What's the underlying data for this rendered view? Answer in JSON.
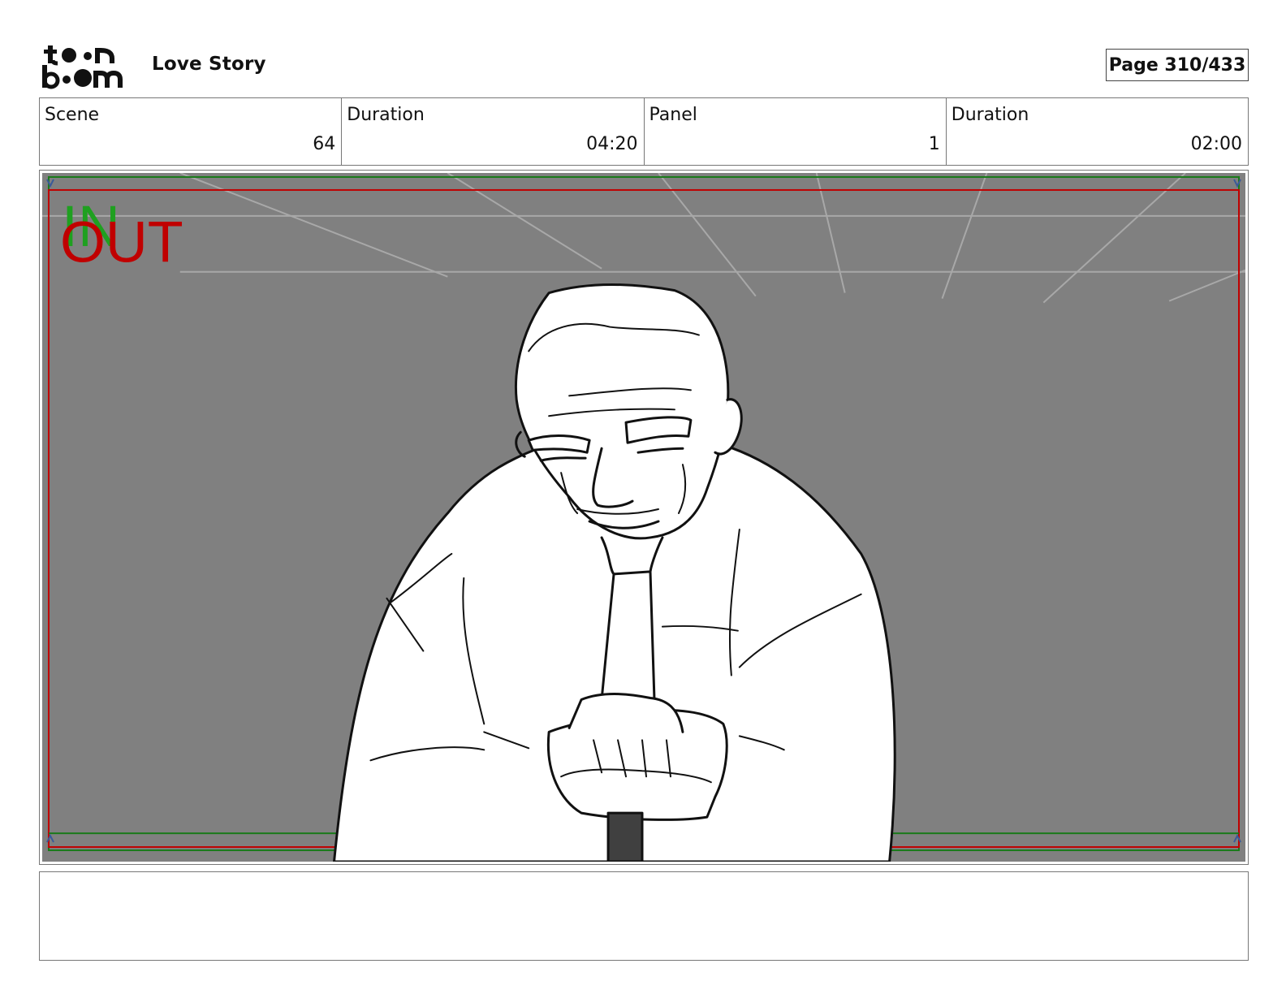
{
  "header": {
    "logo_lines": [
      "toon",
      "boom"
    ],
    "title": "Love Story",
    "page_label": "Page 310/433"
  },
  "info": [
    {
      "label": "Scene",
      "value": "64"
    },
    {
      "label": "Duration",
      "value": "04:20"
    },
    {
      "label": "Panel",
      "value": "1"
    },
    {
      "label": "Duration",
      "value": "02:00"
    }
  ],
  "panel": {
    "in_marker": "IN",
    "out_marker": "OUT",
    "colors": {
      "background": "#808080",
      "in": "#1fa020",
      "out": "#c00000",
      "safe_frame_green": "#1a7a1a",
      "safe_frame_red": "#c00000",
      "safe_frame_blue": "#3a5a9a"
    }
  },
  "notes": {
    "text": ""
  }
}
